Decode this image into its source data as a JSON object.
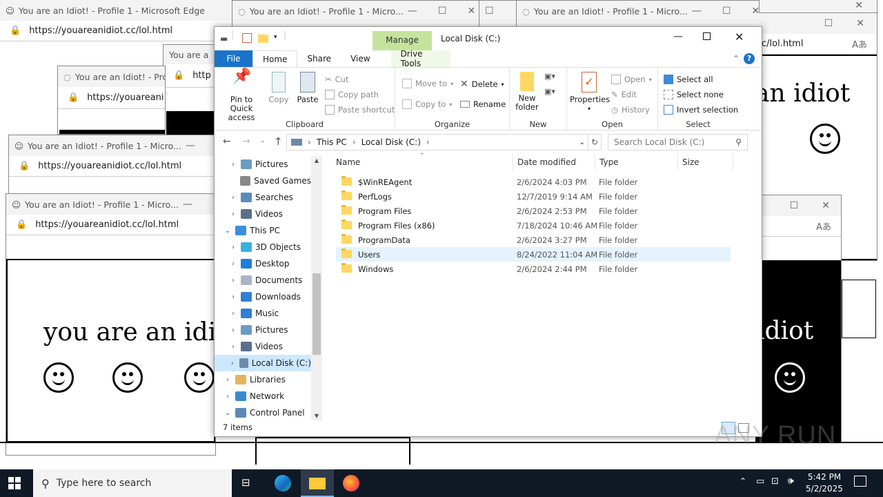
{
  "edge": {
    "title_full": "You are an Idiot! - Profile 1 - Microsoft Edge",
    "title_short": "You are an Idiot! - Profile 1 - Micro...",
    "title_tiny": "You are an Idiot! - Profile",
    "title_stub": "You are a",
    "url": "https://youareanidiot.cc/lol.html",
    "url_cut1": "https://youareani",
    "url_cut2": "http",
    "url_cut3": "https://",
    "url_right": "c/lol.html",
    "page_text": "you are an idiot",
    "page_text_right": "an idiot",
    "page_text_dark": "idiot",
    "reader_icon": "Aᴬ"
  },
  "explorer": {
    "title": "Local Disk (C:)",
    "manage_tab": "Manage",
    "tabs": [
      "File",
      "Home",
      "Share",
      "View",
      "Drive Tools"
    ],
    "clipboard": {
      "pin": "Pin to Quick access",
      "copy": "Copy",
      "paste": "Paste",
      "cut": "Cut",
      "copy_path": "Copy path",
      "paste_shortcut": "Paste shortcut",
      "label": "Clipboard"
    },
    "organize": {
      "move_to": "Move to",
      "copy_to": "Copy to",
      "delete": "Delete",
      "rename": "Rename",
      "label": "Organize"
    },
    "new": {
      "new_folder": "New folder",
      "label": "New"
    },
    "open": {
      "properties": "Properties",
      "open": "Open",
      "edit": "Edit",
      "history": "History",
      "label": "Open"
    },
    "select": {
      "select_all": "Select all",
      "select_none": "Select none",
      "invert": "Invert selection",
      "label": "Select"
    },
    "breadcrumb": [
      "This PC",
      "Local Disk (C:)"
    ],
    "search_placeholder": "Search Local Disk (C:)",
    "nav": [
      {
        "label": "Pictures",
        "icon": "pictures-icon",
        "indent": 1,
        "chev": "›"
      },
      {
        "label": "Saved Games",
        "icon": "saved-games-icon",
        "indent": 1,
        "chev": ""
      },
      {
        "label": "Searches",
        "icon": "searches-icon",
        "indent": 1,
        "chev": "›"
      },
      {
        "label": "Videos",
        "icon": "videos-icon",
        "indent": 1,
        "chev": "›"
      },
      {
        "label": "This PC",
        "icon": "this-pc-icon",
        "indent": 0,
        "chev": "⌄"
      },
      {
        "label": "3D Objects",
        "icon": "3d-objects-icon",
        "indent": 1,
        "chev": "›"
      },
      {
        "label": "Desktop",
        "icon": "desktop-icon",
        "indent": 1,
        "chev": "›"
      },
      {
        "label": "Documents",
        "icon": "documents-icon",
        "indent": 1,
        "chev": "›"
      },
      {
        "label": "Downloads",
        "icon": "downloads-icon",
        "indent": 1,
        "chev": "›"
      },
      {
        "label": "Music",
        "icon": "music-icon",
        "indent": 1,
        "chev": "›"
      },
      {
        "label": "Pictures",
        "icon": "pictures-icon",
        "indent": 1,
        "chev": "›"
      },
      {
        "label": "Videos",
        "icon": "videos-icon",
        "indent": 1,
        "chev": "›"
      },
      {
        "label": "Local Disk (C:)",
        "icon": "local-disk-icon",
        "indent": 1,
        "chev": "›",
        "selected": true
      },
      {
        "label": "Libraries",
        "icon": "libraries-icon",
        "indent": 0,
        "chev": "›"
      },
      {
        "label": "Network",
        "icon": "network-icon",
        "indent": 0,
        "chev": "›"
      },
      {
        "label": "Control Panel",
        "icon": "control-panel-icon",
        "indent": 0,
        "chev": "⌄"
      }
    ],
    "columns": [
      "Name",
      "Date modified",
      "Type",
      "Size"
    ],
    "files": [
      {
        "name": "$WinREAgent",
        "date": "2/6/2024 4:03 PM",
        "type": "File folder"
      },
      {
        "name": "PerfLogs",
        "date": "12/7/2019 9:14 AM",
        "type": "File folder"
      },
      {
        "name": "Program Files",
        "date": "2/6/2024 2:53 PM",
        "type": "File folder"
      },
      {
        "name": "Program Files (x86)",
        "date": "7/18/2024 10:46 AM",
        "type": "File folder"
      },
      {
        "name": "ProgramData",
        "date": "2/6/2024 3:27 PM",
        "type": "File folder"
      },
      {
        "name": "Users",
        "date": "8/24/2022 11:04 AM",
        "type": "File folder",
        "selected": true
      },
      {
        "name": "Windows",
        "date": "2/6/2024 2:44 PM",
        "type": "File folder"
      }
    ],
    "status": "7 items"
  },
  "taskbar": {
    "search_placeholder": "Type here to search",
    "time": "5:42 PM",
    "date": "5/2/2025"
  },
  "watermark": "ANY RUN",
  "colors": {
    "accent": "#1a73c9",
    "manage": "#c4e49c",
    "selection": "#cce8ff",
    "taskbar": "#101a26"
  }
}
